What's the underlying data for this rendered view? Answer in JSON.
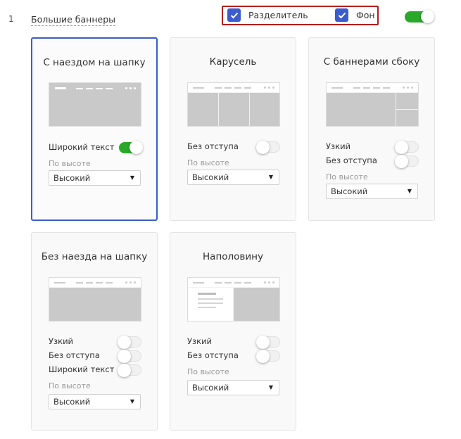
{
  "row": {
    "number": "1",
    "title": "Большие баннеры"
  },
  "header": {
    "separator_label": "Разделитель",
    "background_label": "Фон",
    "enabled": true
  },
  "colors": {
    "accent": "#3a5ccc",
    "toggle_on": "#2aa82a",
    "highlight": "#b21e1e"
  },
  "cards": [
    {
      "title": "С наездом на шапку",
      "selected": true,
      "options": [
        {
          "label": "Широкий текст",
          "on": true
        }
      ],
      "height_label": "По высоте",
      "height_value": "Высокий"
    },
    {
      "title": "Карусель",
      "selected": false,
      "options": [
        {
          "label": "Без отступа",
          "on": false
        }
      ],
      "height_label": "По высоте",
      "height_value": "Высокий"
    },
    {
      "title": "С баннерами сбоку",
      "selected": false,
      "options": [
        {
          "label": "Узкий",
          "on": false
        },
        {
          "label": "Без отступа",
          "on": false
        }
      ],
      "height_label": "По высоте",
      "height_value": "Высокий"
    },
    {
      "title": "Без наезда на шапку",
      "selected": false,
      "options": [
        {
          "label": "Узкий",
          "on": false
        },
        {
          "label": "Без отступа",
          "on": false
        },
        {
          "label": "Широкий текст",
          "on": false
        }
      ],
      "height_label": "По высоте",
      "height_value": "Высокий"
    },
    {
      "title": "Наполовину",
      "selected": false,
      "options": [
        {
          "label": "Узкий",
          "on": false
        },
        {
          "label": "Без отступа",
          "on": false
        }
      ],
      "height_label": "По высоте",
      "height_value": "Высокий"
    }
  ]
}
